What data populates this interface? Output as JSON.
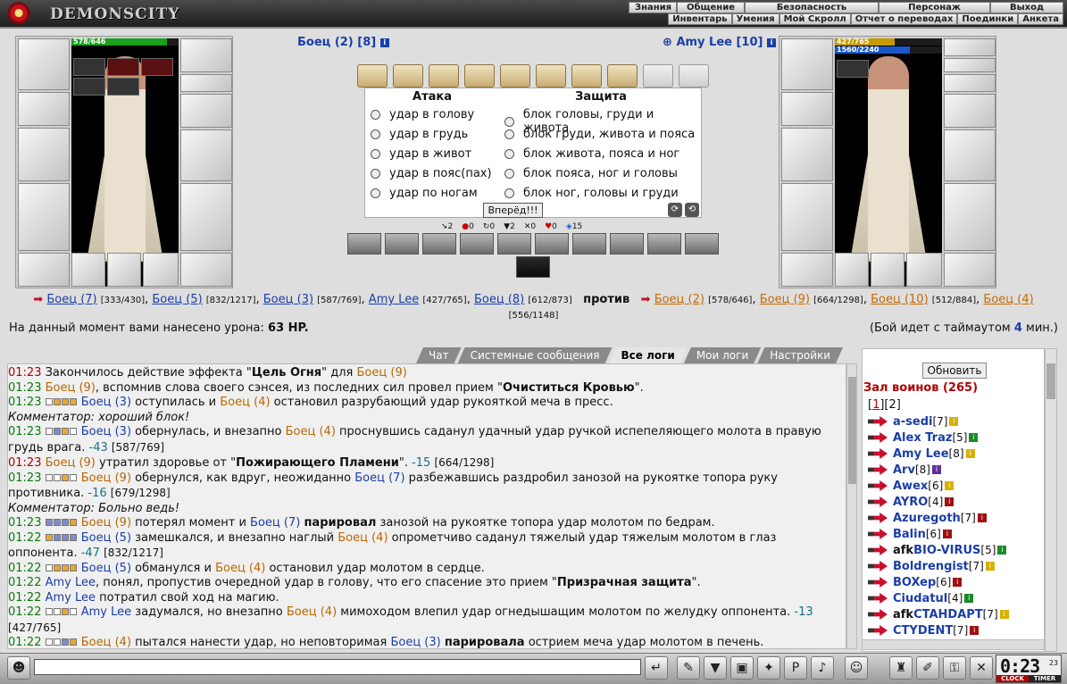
{
  "header": {
    "logo": "DEMONSCITY",
    "menu_top": [
      "Знания",
      "Общение",
      "Безопасность",
      "Персонаж",
      "Выход"
    ],
    "menu_bottom": [
      "Инвентарь",
      "Умения",
      "Мой Скролл",
      "Отчет о переводах",
      "Поединки",
      "Анкета"
    ]
  },
  "left_fighter": {
    "hp": "578/646",
    "name": "Боец (2) [8]"
  },
  "right_fighter": {
    "hp": "427/765",
    "mana": "1560/2240",
    "name": "Amy Lee [10]"
  },
  "attack": {
    "attack_title": "Атака",
    "defense_title": "Защита",
    "attacks": [
      "удар в голову",
      "удар в грудь",
      "удар в живот",
      "удар в пояс(пах)",
      "удар по ногам"
    ],
    "defenses": [
      "блок головы, груди и живота",
      "блок груди, живота и пояса",
      "блок живота, пояса и ног",
      "блок пояса, ног и головы",
      "блок ног, головы и груди"
    ],
    "go_button": "Вперёд!!!"
  },
  "stats": [
    "2",
    "0",
    "0",
    "2",
    "0",
    "0",
    "15"
  ],
  "vs": {
    "left": [
      {
        "name": "Боец (7)",
        "hp": "[333/430]"
      },
      {
        "name": "Боец (5)",
        "hp": "[832/1217]"
      },
      {
        "name": "Боец (3)",
        "hp": "[587/769]"
      },
      {
        "name": "Amy Lee",
        "hp": "[427/765]"
      },
      {
        "name": "Боец (8)",
        "hp": "[612/873]"
      }
    ],
    "word": "против",
    "right": [
      {
        "name": "Боец (2)",
        "hp": "[578/646]"
      },
      {
        "name": "Боец (9)",
        "hp": "[664/1298]"
      },
      {
        "name": "Боец (10)",
        "hp": "[512/884]"
      },
      {
        "name": "Боец (4)",
        "hp": "[556/1148]"
      }
    ]
  },
  "damage_label": "На данный момент вами нанесено урона:",
  "damage_value": "63 HP.",
  "timeout_text": "(Бой идет с таймаутом",
  "timeout_value": "4",
  "timeout_suffix": "мин.)",
  "tabs": [
    "Чат",
    "Системные сообщения",
    "Все логи",
    "Мои логи",
    "Настройки"
  ],
  "right_panel": {
    "refresh": "Обновить",
    "hall": "Зал воинов (265)",
    "page1": "1",
    "page2": "2",
    "players": [
      {
        "name": "a-sedi",
        "lvl": "[7]",
        "icon": "#d9b100"
      },
      {
        "name": "Alex Traz",
        "lvl": "[5]",
        "icon": "#1a8a2a"
      },
      {
        "name": "Amy Lee",
        "lvl": "[8]",
        "icon": "#d9b100"
      },
      {
        "name": "Arv",
        "lvl": "[8]",
        "icon": "#6030a0"
      },
      {
        "name": "Awex",
        "lvl": "[6]",
        "icon": "#d9b100"
      },
      {
        "name": "AYRO",
        "lvl": "[4]",
        "icon": "#a01010"
      },
      {
        "name": "Azuregoth",
        "lvl": "[7]",
        "icon": "#a01010"
      },
      {
        "name": "Balin",
        "lvl": "[6]",
        "icon": "#a01010"
      },
      {
        "name": "BIO-VIRUS",
        "lvl": "[5]",
        "icon": "#1a8a2a",
        "afk": "afk"
      },
      {
        "name": "Boldrengist",
        "lvl": "[7]",
        "icon": "#d9b100"
      },
      {
        "name": "BOXep",
        "lvl": "[6]",
        "icon": "#a01010"
      },
      {
        "name": "Ciudatul",
        "lvl": "[4]",
        "icon": "#1a8a2a"
      },
      {
        "name": "CTAHDAPT",
        "lvl": "[7]",
        "icon": "#d9b100",
        "afk": "afk"
      },
      {
        "name": "CTYDENT",
        "lvl": "[7]",
        "icon": "#a01010"
      }
    ]
  },
  "clock": {
    "time": "0:23",
    "sec": "23",
    "clock_label": "CLOCK",
    "timer_label": "TIMER"
  }
}
